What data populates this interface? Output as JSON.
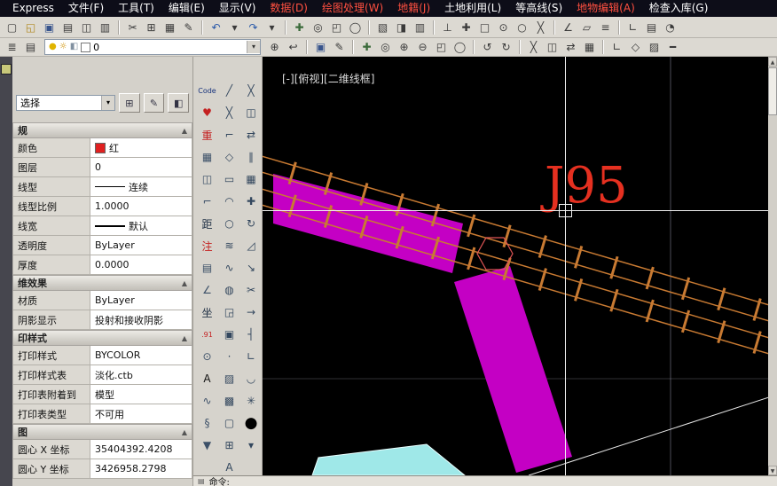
{
  "ui": {
    "chevron_down": "▾",
    "collapse_arrow": "▲"
  },
  "menu_bar": {
    "items": [
      {
        "name": "menu-express",
        "label": "Express",
        "color": "#ffffff"
      },
      {
        "name": "menu-file",
        "label": "文件(F)",
        "color": "#ffffff"
      },
      {
        "name": "menu-tools",
        "label": "工具(T)",
        "color": "#ffffff"
      },
      {
        "name": "menu-edit",
        "label": "编辑(E)",
        "color": "#ffffff"
      },
      {
        "name": "menu-view",
        "label": "显示(V)",
        "color": "#ffffff"
      },
      {
        "name": "menu-data",
        "label": "数据(D)",
        "color": "#ff5040"
      },
      {
        "name": "menu-draw-process",
        "label": "绘图处理(W)",
        "color": "#ff5040"
      },
      {
        "name": "menu-cadastre",
        "label": "地籍(J)",
        "color": "#ff5040"
      },
      {
        "name": "menu-land-use",
        "label": "土地利用(L)",
        "color": "#ffffff"
      },
      {
        "name": "menu-contour",
        "label": "等高线(S)",
        "color": "#ffffff"
      },
      {
        "name": "menu-feature-edit",
        "label": "地物编辑(A)",
        "color": "#ff5040"
      },
      {
        "name": "menu-check-storage",
        "label": "检查入库(G)",
        "color": "#ffffff"
      }
    ]
  },
  "toolbar_standard": {
    "buttons": [
      {
        "name": "new-file-icon",
        "glyph": "▢"
      },
      {
        "name": "open-file-icon",
        "glyph": "◱",
        "color": "#b08820"
      },
      {
        "name": "save-file-icon",
        "glyph": "▣",
        "color": "#38548c"
      },
      {
        "name": "plot-icon",
        "glyph": "▤"
      },
      {
        "name": "plot-preview-icon",
        "glyph": "◫"
      },
      {
        "name": "publish-icon",
        "glyph": "▥"
      },
      {
        "name": "cut-icon",
        "glyph": "✂",
        "gap": true
      },
      {
        "name": "copy-clip-icon",
        "glyph": "⊞"
      },
      {
        "name": "paste-icon",
        "glyph": "▦"
      },
      {
        "name": "match-properties-icon",
        "glyph": "✎"
      },
      {
        "name": "undo-icon",
        "glyph": "↶",
        "color": "#2858a8",
        "gap": true
      },
      {
        "name": "undo-list-arrow",
        "glyph": "▾"
      },
      {
        "name": "redo-icon",
        "glyph": "↷",
        "color": "#2858a8"
      },
      {
        "name": "redo-list-arrow",
        "glyph": "▾"
      },
      {
        "name": "pan-icon",
        "glyph": "✚",
        "color": "#3a6a3a",
        "gap": true
      },
      {
        "name": "zoom-realtime-icon",
        "glyph": "◎"
      },
      {
        "name": "zoom-window-icon",
        "glyph": "◰"
      },
      {
        "name": "zoom-previous-icon",
        "glyph": "◯"
      },
      {
        "name": "properties-palette-icon",
        "glyph": "▧",
        "gap": true
      },
      {
        "name": "design-center-icon",
        "glyph": "◨"
      },
      {
        "name": "tool-palettes-icon",
        "glyph": "▥"
      },
      {
        "name": "snap-tracking-icon",
        "glyph": "⊥",
        "gap": true
      },
      {
        "name": "snap-from-icon",
        "glyph": "✚"
      },
      {
        "name": "snap-endpoint-icon",
        "glyph": "□"
      },
      {
        "name": "snap-center-icon",
        "glyph": "⊙"
      },
      {
        "name": "snap-node-icon",
        "glyph": "○"
      },
      {
        "name": "snap-intersection-icon",
        "glyph": "╳"
      },
      {
        "name": "measure-distance-icon",
        "glyph": "∠",
        "gap": true
      },
      {
        "name": "measure-area-icon",
        "glyph": "▱"
      },
      {
        "name": "list-icon",
        "glyph": "≡"
      },
      {
        "name": "ucs-icon",
        "glyph": "∟",
        "gap": true
      },
      {
        "name": "named-views-icon",
        "glyph": "▤"
      },
      {
        "name": "orbit-icon",
        "glyph": "◔"
      }
    ]
  },
  "toolbar_layers": {
    "manager_button": {
      "glyph": "≣"
    },
    "states_button": {
      "glyph": "▤"
    },
    "combo": {
      "bulb": "●",
      "freeze": "☼",
      "lock": "◧",
      "current_layer": "0"
    },
    "buttons": [
      {
        "name": "make-object-layer-current-icon",
        "glyph": "⊕"
      },
      {
        "name": "layer-previous-icon",
        "glyph": "↩"
      },
      {
        "name": "save-quick-icon",
        "glyph": "▣",
        "color": "#38548c",
        "gap": true
      },
      {
        "name": "edit-icon",
        "glyph": "✎"
      },
      {
        "name": "pan-hand-icon",
        "glyph": "✚",
        "color": "#3a6a3a",
        "gap": true
      },
      {
        "name": "zoom-realtime2-icon",
        "glyph": "◎"
      },
      {
        "name": "zoom-in-icon",
        "glyph": "⊕"
      },
      {
        "name": "zoom-out-icon",
        "glyph": "⊖"
      },
      {
        "name": "zoom-window2-icon",
        "glyph": "◰"
      },
      {
        "name": "zoom-extents-icon",
        "glyph": "◯"
      },
      {
        "name": "redraw-icon",
        "glyph": "↺",
        "gap": true
      },
      {
        "name": "regen-icon",
        "glyph": "↻"
      },
      {
        "name": "erase-quick-icon",
        "glyph": "╳",
        "gap": true
      },
      {
        "name": "copy-quick-icon",
        "glyph": "◫"
      },
      {
        "name": "mirror-quick-icon",
        "glyph": "⇄"
      },
      {
        "name": "array-quick-icon",
        "glyph": "▦"
      },
      {
        "name": "ortho-icon",
        "glyph": "∟",
        "gap": true
      },
      {
        "name": "osnap-toggle-icon",
        "glyph": "◇"
      },
      {
        "name": "hatch-quick-icon",
        "glyph": "▨"
      },
      {
        "name": "lineweight-display-icon",
        "glyph": "━"
      }
    ]
  },
  "side_toolbar_cass": {
    "buttons": [
      {
        "name": "code-tool-button",
        "glyph": "Code",
        "color": "#16327c",
        "small": true
      },
      {
        "name": "favorite-tool-button",
        "glyph": "♥",
        "color": "#c42020"
      },
      {
        "name": "redraw-cass-button",
        "glyph": "重",
        "color": "#c42020"
      },
      {
        "name": "grid-display-button",
        "glyph": "▦",
        "color": "#3c5068"
      },
      {
        "name": "pan-window-button",
        "glyph": "◫",
        "color": "#3c5068"
      },
      {
        "name": "corner-tool-button",
        "glyph": "⌐",
        "color": "#3c5068"
      },
      {
        "name": "distance-tool-button",
        "glyph": "距",
        "color": "#243448"
      },
      {
        "name": "annotation-tool-button",
        "glyph": "注",
        "color": "#c42020"
      },
      {
        "name": "ruler-tool-button",
        "glyph": "▤",
        "color": "#3c5068"
      },
      {
        "name": "angle-tool-button",
        "glyph": "∠",
        "color": "#3c5068"
      },
      {
        "name": "coordinate-tool-button",
        "glyph": "坐",
        "color": "#243448"
      },
      {
        "name": "scale-point91-button",
        "glyph": ".91",
        "color": "#c42020",
        "small": true
      },
      {
        "name": "target-tool-button",
        "glyph": "⊙",
        "color": "#3c5068"
      },
      {
        "name": "text-style-button",
        "glyph": "A",
        "color": "#111111"
      },
      {
        "name": "curve-tool-button",
        "glyph": "∿",
        "color": "#3c5068"
      },
      {
        "name": "section-tool-button",
        "glyph": "§",
        "color": "#3c5068"
      },
      {
        "name": "down-arrow-button",
        "glyph": "▼",
        "color": "#3c5068"
      }
    ]
  },
  "side_toolbar_draw": {
    "buttons": [
      {
        "name": "line-tool-button",
        "glyph": "╱"
      },
      {
        "name": "construction-line-tool-button",
        "glyph": "╳"
      },
      {
        "name": "polyline-tool-button",
        "glyph": "⌐"
      },
      {
        "name": "polygon-tool-button",
        "glyph": "◇"
      },
      {
        "name": "rectangle-tool-button",
        "glyph": "▭"
      },
      {
        "name": "arc-tool-button",
        "glyph": "◠"
      },
      {
        "name": "circle-tool-button",
        "glyph": "○"
      },
      {
        "name": "revision-cloud-tool-button",
        "glyph": "≋"
      },
      {
        "name": "spline-tool-button",
        "glyph": "∿"
      },
      {
        "name": "ellipse-tool-button",
        "glyph": "◍"
      },
      {
        "name": "insert-block-tool-button",
        "glyph": "◲"
      },
      {
        "name": "make-block-tool-button",
        "glyph": "▣"
      },
      {
        "name": "point-tool-button",
        "glyph": "·"
      },
      {
        "name": "hatch-tool-button",
        "glyph": "▨"
      },
      {
        "name": "gradient-tool-button",
        "glyph": "▩"
      },
      {
        "name": "region-tool-button",
        "glyph": "▢"
      },
      {
        "name": "table-tool-button",
        "glyph": "⊞"
      },
      {
        "name": "multiline-text-tool-button",
        "glyph": "A"
      }
    ]
  },
  "side_toolbar_modify": {
    "buttons": [
      {
        "name": "erase-tool-button",
        "glyph": "╳"
      },
      {
        "name": "copy-tool-button",
        "glyph": "◫"
      },
      {
        "name": "mirror-tool-button",
        "glyph": "⇄"
      },
      {
        "name": "offset-tool-button",
        "glyph": "∥"
      },
      {
        "name": "array-tool-button",
        "glyph": "▦"
      },
      {
        "name": "move-tool-button",
        "glyph": "✚"
      },
      {
        "name": "rotate-tool-button",
        "glyph": "↻"
      },
      {
        "name": "scale-tool-button",
        "glyph": "◿"
      },
      {
        "name": "stretch-tool-button",
        "glyph": "↘"
      },
      {
        "name": "trim-tool-button",
        "glyph": "✂"
      },
      {
        "name": "extend-tool-button",
        "glyph": "→"
      },
      {
        "name": "break-tool-button",
        "glyph": "┤"
      },
      {
        "name": "chamfer-tool-button",
        "glyph": "∟"
      },
      {
        "name": "fillet-tool-button",
        "glyph": "◡"
      },
      {
        "name": "explode-tool-button",
        "glyph": "✳"
      },
      {
        "name": "render-sphere-button",
        "glyph": "●",
        "big": true
      },
      {
        "name": "expand-toolbar-button",
        "glyph": "▾"
      }
    ]
  },
  "properties_panel": {
    "selector": {
      "value": "选择",
      "buttons": [
        {
          "name": "toggle-pickadd-button",
          "glyph": "⊞"
        },
        {
          "name": "select-objects-button",
          "glyph": "✎"
        },
        {
          "name": "quick-select-button",
          "glyph": "◧"
        }
      ]
    },
    "sections": {
      "general": {
        "title": "规",
        "rows": {
          "color": {
            "label": "颜色",
            "value": "红"
          },
          "layer": {
            "label": "图层",
            "value": "0"
          },
          "linetype": {
            "label": "线型",
            "value": "连续"
          },
          "linetype_scale": {
            "label": "线型比例",
            "value": "1.0000"
          },
          "lineweight": {
            "label": "线宽",
            "value": "默认"
          },
          "transparency": {
            "label": "透明度",
            "value": "ByLayer"
          },
          "thickness": {
            "label": "厚度",
            "value": "0.0000"
          }
        }
      },
      "effects_3d": {
        "title": "维效果",
        "rows": {
          "material": {
            "label": "材质",
            "value": "ByLayer"
          },
          "shadow": {
            "label": "阴影显示",
            "value": "投射和接收阴影"
          }
        }
      },
      "plot_style": {
        "title": "印样式",
        "rows": {
          "style": {
            "label": "打印样式",
            "value": "BYCOLOR"
          },
          "style_table": {
            "label": "打印样式表",
            "value": "淡化.ctb"
          },
          "attached_to": {
            "label": "打印表附着到",
            "value": "模型"
          },
          "table_type": {
            "label": "打印表类型",
            "value": "不可用"
          }
        }
      },
      "view": {
        "title": "图",
        "rows": {
          "center_x": {
            "label": "圆心 X 坐标",
            "value": "35404392.4208"
          },
          "center_y": {
            "label": "圆心 Y 坐标",
            "value": "3426958.2798"
          }
        }
      }
    }
  },
  "viewport": {
    "view_controls_label": "[-][俯视][二维线框]",
    "annotation_text": "J95",
    "annotation_color": "#e53020",
    "boundary_color": "#c87a32",
    "parcel_color": "#c400c4",
    "water_color": "#9fe8e8"
  },
  "scrollbar": {
    "up": "▲",
    "down": "▼"
  },
  "command_line": {
    "icon": "▤",
    "prompt": "命令:"
  }
}
